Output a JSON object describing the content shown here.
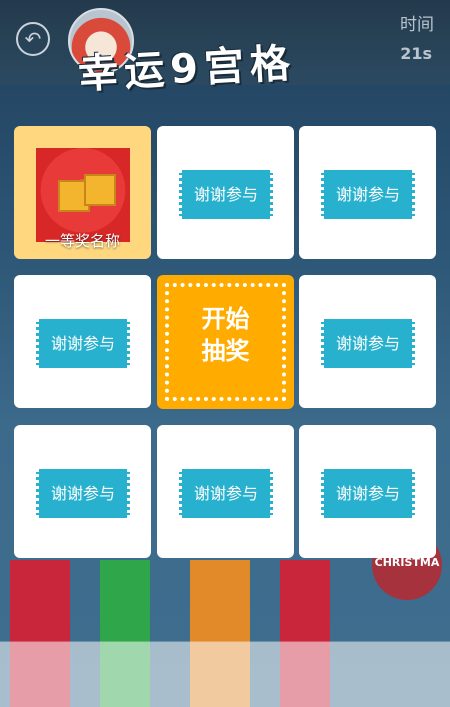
{
  "header": {
    "title": "幸运9宫格",
    "time_label": "时间",
    "time_value": "21s"
  },
  "grid": {
    "cells": [
      {
        "label": "一等奖名称"
      },
      {
        "label": "谢谢参与"
      },
      {
        "label": "谢谢参与"
      },
      {
        "label": "谢谢参与"
      },
      {
        "label": "谢谢参与"
      },
      {
        "label": "谢谢参与"
      },
      {
        "label": "谢谢参与"
      },
      {
        "label": "谢谢参与"
      }
    ],
    "start_line1": "开始",
    "start_line2": "抽奖"
  },
  "background": {
    "badge_text": "CHRISTMA"
  },
  "colors": {
    "accent_orange": "#ffab00",
    "ticket_blue": "#27b1ce",
    "prize_cell": "#ffd77f"
  }
}
